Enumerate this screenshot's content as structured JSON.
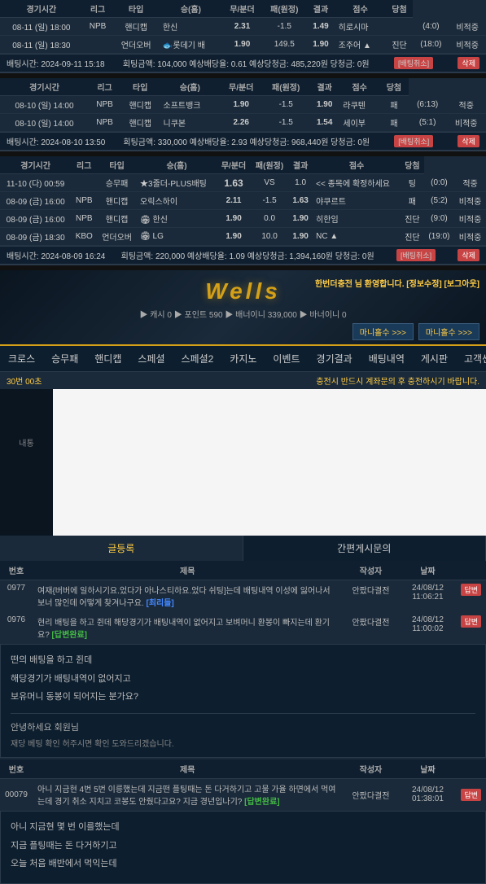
{
  "header": {
    "columns": [
      "경기시간",
      "리그",
      "타입",
      "승(홈)",
      "무/분더",
      "패(원정)",
      "결과",
      "점수",
      "당첨"
    ]
  },
  "section1": {
    "rows": [
      {
        "time": "08-11 (일) 18:00",
        "league": "NPB",
        "type": "핸디캡",
        "team_home": "한신",
        "odds_home": "2.31",
        "odds_draw": "-1.5",
        "odds_away": "1.49",
        "team_away": "히로시마",
        "result": "",
        "score": "(4:0)",
        "status": "비적중",
        "status_class": "status-red"
      },
      {
        "time": "08-11 (일) 18:30",
        "league": "",
        "type": "언더오버",
        "team_home": "롯데기 배",
        "odds_home": "1.90",
        "odds_draw": "149.5",
        "odds_away": "1.90",
        "team_away": "조주어",
        "result": "진단",
        "score": "(18:0)",
        "status": "비적중",
        "status_class": "status-red"
      }
    ],
    "info": {
      "date": "배팅시간: 2024-09-11 15:18",
      "text": "회팅금액: 104,000 예상배당율: 0.61 예상당청금: 485,220원 당청금: 0원",
      "link": "[배팅취소]",
      "btn": "삭제"
    }
  },
  "section2": {
    "rows": [
      {
        "time": "08-10 (일) 14:00",
        "league": "NPB",
        "type": "핸디캡",
        "team_home": "소프트뱅크",
        "odds_home": "1.90",
        "odds_draw": "-1.5",
        "odds_away": "1.90",
        "team_away": "라쿠텐",
        "result": "패",
        "score": "(6:13)",
        "status": "적중",
        "status_class": "status-green"
      },
      {
        "time": "08-10 (일) 14:00",
        "league": "NPB",
        "type": "핸디캡",
        "team_home": "니쿠본",
        "odds_home": "2.26",
        "odds_draw": "-1.5",
        "odds_away": "1.54",
        "team_away": "세이부",
        "result": "패",
        "score": "(5:1)",
        "status": "비적중",
        "status_class": "status-red"
      }
    ],
    "info": {
      "date": "배팅시간: 2024-08-10 13:50",
      "text": "회팅금액: 330,000 예상배당율: 2.93 예상당청금: 968,440원 당청금: 0원",
      "link": "[배팅취소]",
      "btn": "삭제"
    }
  },
  "section3": {
    "rows": [
      {
        "time": "11-10 (다) 00:59",
        "league": "",
        "type": "승무패",
        "team_home": "★3줄더-PLUS배팅",
        "odds_home": "1.63",
        "odds_draw": "VS",
        "odds_away": "1.0",
        "team_away": "<< 종목에 확정하세요",
        "result": "팅",
        "score": "(0:0)",
        "status": "적중",
        "status_class": "status-green"
      },
      {
        "time": "08-09 (금) 16:00",
        "league": "NPB",
        "type": "핸디캡",
        "team_home": "오릭스하이",
        "odds_home": "2.11",
        "odds_draw": "-1.5",
        "odds_away": "1.63",
        "team_away": "야쿠르트",
        "result": "패",
        "score": "(5:2)",
        "status": "비적중",
        "status_class": "status-red"
      },
      {
        "time": "08-09 (금) 16:00",
        "league": "NPB",
        "type": "핸디캡",
        "team_home": "한신",
        "odds_home": "1.90",
        "odds_draw": "0.0",
        "odds_away": "1.90",
        "team_away": "히한임",
        "result": "진단",
        "score": "(9:0)",
        "status": "비적중",
        "status_class": "status-red"
      },
      {
        "time": "08-09 (금) 18:30",
        "league": "KBO",
        "type": "언더오버",
        "team_home": "LG",
        "odds_home": "1.90",
        "odds_draw": "10.0",
        "odds_away": "1.90",
        "team_away": "NC",
        "result": "진단",
        "score": "(19:0)",
        "status": "비적중",
        "status_class": "status-red"
      }
    ],
    "info": {
      "date": "배팅시간: 2024-08-09 16:24",
      "text": "회팅금액: 220,000 예상배당율: 1.09 예상당청금: 1,394,160원 당청금: 0원",
      "link": "[배팅취소]",
      "btn": "삭제"
    }
  },
  "wells": {
    "title": "Wells",
    "notice": "한번더충전 님 환영합니다. [정보수정] [보그아웃]",
    "points_prefix": "▶ 캐시 0 ▶ 포인트 590 ▶ 배너이니 339,000 ▶ 바너이니 0",
    "manage_btn1": "마니홀수 >>>",
    "manage_btn2": "마니홀수 >>>"
  },
  "nav": {
    "items": [
      "크로스",
      "승무패",
      "핸디캡",
      "스페셜",
      "스페셜2",
      "카지노",
      "이벤트",
      "경기결과",
      "배팅내역",
      "게시판",
      "고객센터"
    ]
  },
  "notice": {
    "text": "30번 00초",
    "warning": "충전시 반드시 계좌문의 후 충전하시기 바랍니다."
  },
  "main_area": {
    "left_label": "내통",
    "content_empty": ""
  },
  "board": {
    "tabs": [
      "글등록",
      "간편게시문의"
    ],
    "active_tab": 0,
    "columns": [
      "번호",
      "제목",
      "작성자",
      "날짜"
    ],
    "rows": [
      {
        "no": "0977",
        "title": "여재{버버에 일하시기요.었다가 아나스티하요.었다 쉬팅]는데 배팅내역 이성에 잃어나서 보너 많인데 어떻게 찾겨나구요.",
        "tag": "[최리들]",
        "tag_class": "tag-blue",
        "author": "안팠다결전",
        "date": "24/08/12\n11:06:21",
        "btn": "답변"
      },
      {
        "no": "0976",
        "title": "현리 배팅을 하고 쥔데 해당경기가 배팅내역이 없어지고 보벼머니 환봉이 빠지는데 환기요?",
        "tag": "[답변완료]",
        "tag_class": "tag-green",
        "author": "안팠다결전",
        "date": "24/08/12\n11:00:02",
        "btn": "답변",
        "expanded": true
      }
    ],
    "expanded_post": {
      "lines": [
        "떤의 배팅을 하고 쥔데",
        "해당경기가 배팅내역이 없어지고",
        "보유머니 동봉이 되어지는 분가요?"
      ]
    }
  },
  "board2": {
    "columns": [
      "번호",
      "제목",
      "작성자",
      "날짜"
    ],
    "rows": [
      {
        "no": "00079",
        "title": "아니 지금현 4번 5번 이릉했는데 지금떤 플팅때는 돈 다거하기고 고물 가율 하면에서 먹여는데 경기 취소 지치고 코봉도 안줬다고요? 지금 경년입나기?",
        "tag": "[답변완료]",
        "tag_class": "tag-green",
        "author": "안팠다결전",
        "date": "24/08/12\n01:38:01",
        "btn": "답변",
        "expanded": true
      }
    ],
    "expanded_post2": {
      "lines": [
        "아니 지금현 몇 번 이를했는데",
        "지금 플팅때는 돈 다거하기고",
        "오늘 처음 배반에서 먹익는데"
      ]
    }
  },
  "greeting": {
    "text": "안녕하세요 회원님",
    "sub": "재당 베팅 확인 허주시면 확인 도와드리겠습니다."
  }
}
